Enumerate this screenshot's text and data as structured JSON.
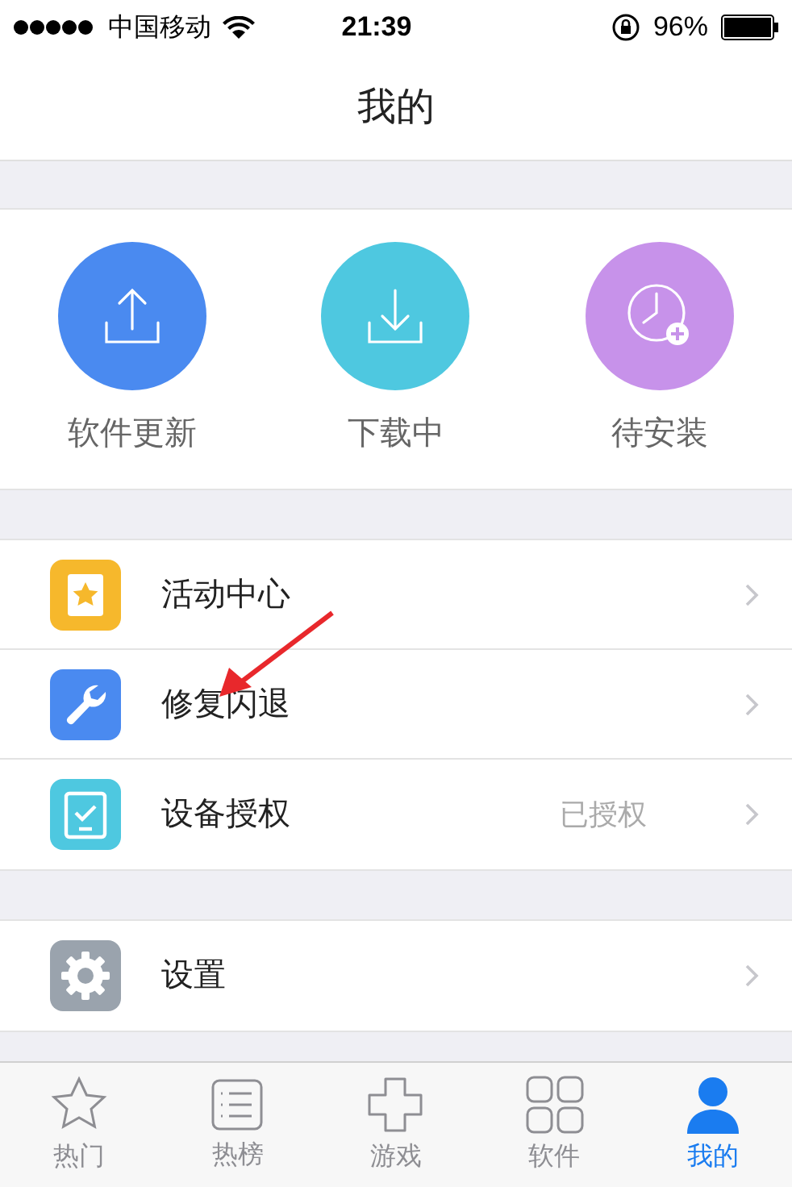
{
  "status_bar": {
    "carrier": "中国移动",
    "time": "21:39",
    "battery": "96%"
  },
  "nav": {
    "title": "我的"
  },
  "shortcuts": [
    {
      "kind": "upload",
      "label": "软件更新",
      "color": "#4a8af0"
    },
    {
      "kind": "download",
      "label": "下载中",
      "color": "#4ec8e0"
    },
    {
      "kind": "pending",
      "label": "待安装",
      "color": "#c792ea"
    }
  ],
  "menu_groups": [
    [
      {
        "kind": "star",
        "label": "活动中心",
        "color": "#f6b82c"
      },
      {
        "kind": "wrench",
        "label": "修复闪退",
        "color": "#4a8af0"
      },
      {
        "kind": "tablet",
        "label": "设备授权",
        "color": "#4ec8e0",
        "value": "已授权"
      }
    ],
    [
      {
        "kind": "gear",
        "label": "设置",
        "color": "#9aa3ad"
      }
    ]
  ],
  "tab_bar": [
    {
      "kind": "star",
      "label": "热门",
      "selected": false
    },
    {
      "kind": "list",
      "label": "热榜",
      "selected": false
    },
    {
      "kind": "dpad",
      "label": "游戏",
      "selected": false
    },
    {
      "kind": "grid",
      "label": "软件",
      "selected": false
    },
    {
      "kind": "person",
      "label": "我的",
      "selected": true
    }
  ]
}
